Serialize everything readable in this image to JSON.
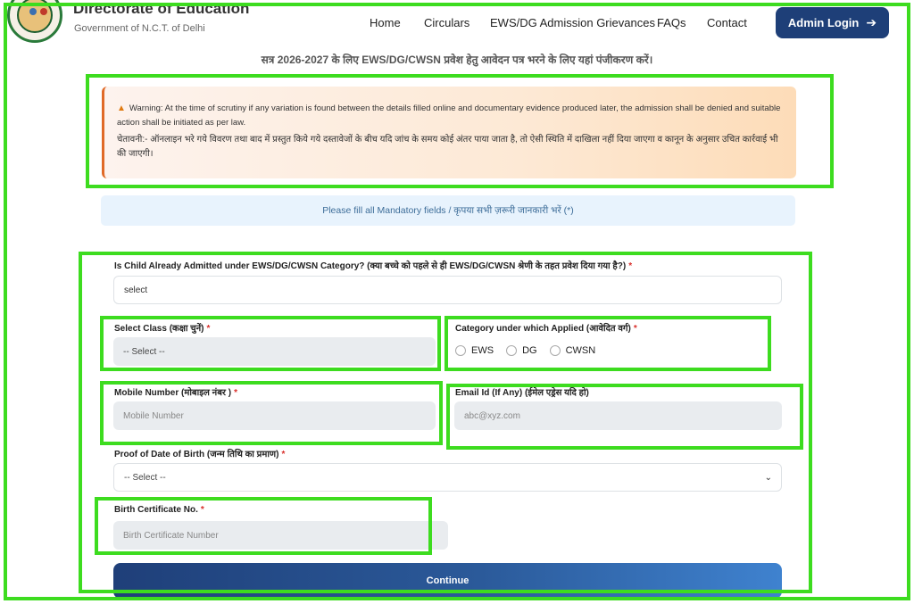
{
  "header": {
    "org_title": "Directorate of Education",
    "org_subtitle": "Government of N.C.T. of Delhi",
    "nav": [
      "Home",
      "Circulars",
      "EWS/DG Admission Grievances",
      "FAQs",
      "Contact"
    ],
    "admin_login_label": "Admin Login",
    "logo_icon": "doe-seal-logo"
  },
  "session_title": "सत्र 2026-2027 के लिए EWS/DG/CWSN प्रवेश हेतु आवेदन पत्र भरने के लिए यहां पंजीकरण करें।",
  "warning": {
    "icon": "warning-triangle-icon",
    "text_en": "Warning: At the time of scrutiny if any variation is found between the details filled online and documentary evidence produced later, the admission shall be denied and suitable action shall be initiated as per law.",
    "text_hi": "चेतावनी:- ऑनलाइन भरे गये विवरण तथा बाद में प्रस्तुत किये गये दस्तावेजों के बीच यदि जांच के समय कोई अंतर पाया जाता है, तो ऐसी स्थिति में दाखिला नहीं दिया जाएगा व कानून के अनुसार उचित कार्रवाई भी की जाएगी।"
  },
  "mandatory_note": "Please fill all Mandatory fields / कृपया सभी ज़रूरी जानकारी भरें (*)",
  "form": {
    "admitted_label": "Is Child Already Admitted under EWS/DG/CWSN Category? (क्या बच्चे को पहले से ही EWS/DG/CWSN श्रेणी के तहत प्रवेश दिया गया है?)",
    "admitted_value": "select",
    "class_label": "Select Class (कक्षा चुनें)",
    "class_value": "-- Select --",
    "category_label": "Category under which Applied (आवेदित वर्ग)",
    "category_options": [
      "EWS",
      "DG",
      "CWSN"
    ],
    "mobile_label": "Mobile Number (मोबाइल नंबर )",
    "mobile_placeholder": "Mobile Number",
    "email_label": "Email Id (If Any) (ईमेल एड्रेस यदि हो)",
    "email_placeholder": "abc@xyz.com",
    "proof_label": "Proof of Date of Birth (जन्म तिथि का प्रमाण)",
    "proof_value": "-- Select --",
    "birth_label": "Birth Certificate No.",
    "birth_placeholder": "Birth Certificate Number",
    "required_mark": "*",
    "continue_label": "Continue"
  },
  "colors": {
    "annotation_box": "#3ddc1f",
    "primary": "#1e3f78",
    "required": "#d9302c"
  }
}
